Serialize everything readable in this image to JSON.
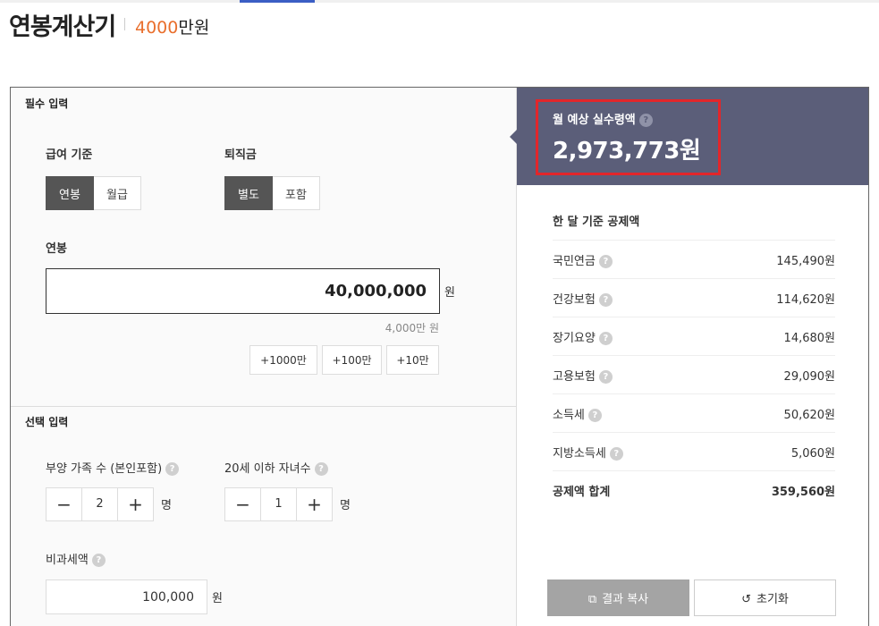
{
  "header": {
    "title": "연봉계산기",
    "amount_number": "4000",
    "amount_unit": "만원"
  },
  "required": {
    "section_label": "필수 입력",
    "salary_basis": {
      "label": "급여 기준",
      "options": [
        "연봉",
        "월급"
      ],
      "selected": "연봉"
    },
    "severance": {
      "label": "퇴직금",
      "options": [
        "별도",
        "포함"
      ],
      "selected": "별도"
    },
    "salary": {
      "label": "연봉",
      "value": "40,000,000",
      "unit": "원",
      "hint": "4,000만 원",
      "quick_buttons": [
        "+1000만",
        "+100만",
        "+10만"
      ]
    }
  },
  "optional": {
    "section_label": "선택 입력",
    "dependents": {
      "label": "부양 가족 수 (본인포함)",
      "value": "2",
      "unit": "명"
    },
    "children": {
      "label": "20세 이하 자녀수",
      "value": "1",
      "unit": "명"
    },
    "nontaxable": {
      "label": "비과세액",
      "value": "100,000",
      "unit": "원"
    }
  },
  "result": {
    "label": "월 예상 실수령액",
    "value": "2,973,773원",
    "deduction_title": "한 달 기준 공제액",
    "deductions": [
      {
        "name": "국민연금",
        "amount": "145,490원"
      },
      {
        "name": "건강보험",
        "amount": "114,620원"
      },
      {
        "name": "장기요양",
        "amount": "14,680원"
      },
      {
        "name": "고용보험",
        "amount": "29,090원"
      },
      {
        "name": "소득세",
        "amount": "50,620원"
      },
      {
        "name": "지방소득세",
        "amount": "5,060원"
      }
    ],
    "total": {
      "name": "공제액 합계",
      "amount": "359,560원"
    },
    "copy_label": "결과 복사",
    "reset_label": "초기화"
  },
  "icons": {
    "help": "?",
    "minus": "−",
    "plus": "+",
    "copy": "⧉",
    "reset": "↺"
  },
  "colors": {
    "accent": "#e96f2d",
    "result_bg": "#5b5e79",
    "highlight": "#e2262a",
    "selected": "#555555"
  }
}
